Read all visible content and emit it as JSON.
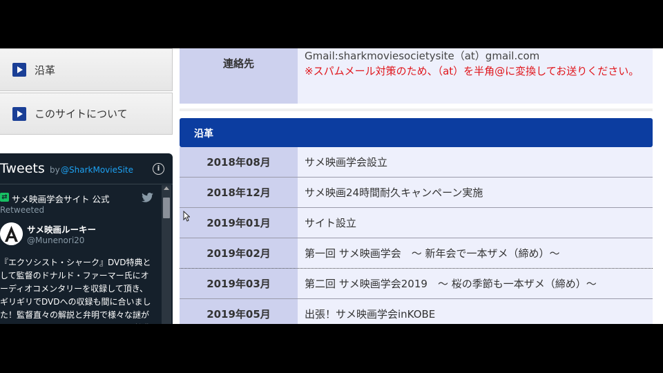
{
  "sidebar": {
    "items": [
      {
        "label": "沿革"
      },
      {
        "label": "このサイトについて"
      }
    ]
  },
  "twitter": {
    "title": "Tweets",
    "by": "by",
    "handle": "@SharkMovieSite",
    "retweeter": "サメ映画学会サイト 公式",
    "retweeted": "Retweeted",
    "author_name": "サメ映画ルーキー",
    "author_handle": "@Munenori20",
    "body": "『エクソシスト・シャーク』DVD特典と\nして監督のドナルド・ファーマー氏にオ\nーディオコメンタリーを収録して頂き、\nギリギリでDVDへの収録も間に合いまし\nた！監督直々の解説と弁明で様々な謎が\n明らかに！なおコメンタリーはDVD特典"
  },
  "contact": {
    "label": "連絡先",
    "email": "Gmail:sharkmoviesocietysite（at）gmail.com",
    "note": "※スパムメール対策のため、（at）を半角@に変換してお送りください。"
  },
  "history": {
    "title": "沿革",
    "rows": [
      {
        "date": "2018年08月",
        "event": "サメ映画学会設立"
      },
      {
        "date": "2018年12月",
        "event": "サメ映画24時間耐久キャンペーン実施"
      },
      {
        "date": "2019年01月",
        "event": "サイト設立"
      },
      {
        "date": "2019年02月",
        "event": "第一回 サメ映画学会　～ 新年会で一本ザメ（締め）～"
      },
      {
        "date": "2019年03月",
        "event": "第二回 サメ映画学会2019　～ 桜の季節も一本ザメ（締め）～"
      },
      {
        "date": "2019年05月",
        "event": "出張！サメ映画学会inKOBE"
      }
    ]
  },
  "colors": {
    "accent": "#0c3da0",
    "label_cell": "#cdd1ee",
    "value_cell": "#eef0fc",
    "warning": "#e0151b"
  }
}
